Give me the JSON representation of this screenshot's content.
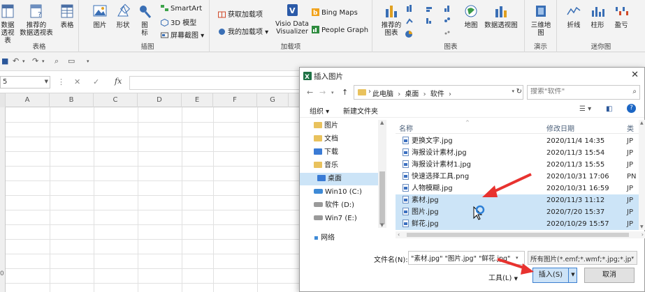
{
  "ribbon": {
    "pivot_label_1": "数据",
    "pivot_label_2": "透视表",
    "recommended_pivot_1": "推荐的",
    "recommended_pivot_2": "数据透视表",
    "table_label": "表格",
    "group_tables": "表格",
    "pictures_label": "图片",
    "shapes_label": "形状",
    "icons_label_1": "图",
    "icons_label_2": "标",
    "smartart_label": "SmartArt",
    "model3d_label": "3D 模型",
    "screenshot_label": "屏幕截图",
    "group_illustrations": "插图",
    "get_addins_label": "获取加载项",
    "my_addins_label": "我的加载项",
    "visio_label_1": "Visio Data",
    "visio_label_2": "Visualizer",
    "bing_maps_label": "Bing Maps",
    "people_graph_label": "People Graph",
    "group_addins": "加载项",
    "recommended_charts_1": "推荐的",
    "recommended_charts_2": "图表",
    "maps_label": "地图",
    "pivot_chart_label": "数据透视图",
    "group_charts": "图表",
    "map3d_label_1": "三维地",
    "map3d_label_2": "图",
    "group_tours": "演示",
    "line_label": "折线",
    "column_label": "柱形",
    "winloss_label": "盈亏",
    "group_sparklines": "迷你图"
  },
  "formula_bar": {
    "name_box": "5",
    "fx": "fx"
  },
  "grid": {
    "columns": [
      "A",
      "B",
      "C",
      "D",
      "E",
      "F",
      "G"
    ],
    "row_mark": "0"
  },
  "dialog": {
    "title": "插入图片",
    "close": "✕",
    "breadcrumb": [
      "此电脑",
      "桌面",
      "软件"
    ],
    "search_placeholder": "搜索\"软件\"",
    "organize_label": "组织 ▾",
    "new_folder_label": "新建文件夹",
    "nav_items": [
      {
        "label": "图片",
        "kind": "folder"
      },
      {
        "label": "文档",
        "kind": "folder"
      },
      {
        "label": "下载",
        "kind": "folder-blue"
      },
      {
        "label": "音乐",
        "kind": "folder"
      },
      {
        "label": "桌面",
        "kind": "folder-blue"
      },
      {
        "label": "Win10 (C:)",
        "kind": "drive-win"
      },
      {
        "label": "软件 (D:)",
        "kind": "drive"
      },
      {
        "label": "Win7 (E:)",
        "kind": "drive"
      }
    ],
    "network_label": "网络",
    "columns": {
      "name": "名称",
      "date": "修改日期",
      "type": "类"
    },
    "files": [
      {
        "name": "更换文字.jpg",
        "date": "2020/11/4 14:35",
        "type": "JP",
        "selected": false
      },
      {
        "name": "海报设计素材.jpg",
        "date": "2020/11/3 15:54",
        "type": "JP",
        "selected": false
      },
      {
        "name": "海报设计素材1.jpg",
        "date": "2020/11/3 15:55",
        "type": "JP",
        "selected": false
      },
      {
        "name": "快速选择工具.png",
        "date": "2020/10/31 17:06",
        "type": "PN",
        "selected": false
      },
      {
        "name": "人物模糊.jpg",
        "date": "2020/10/31 16:59",
        "type": "JP",
        "selected": false
      },
      {
        "name": "素材.jpg",
        "date": "2020/11/3 11:12",
        "type": "JP",
        "selected": true
      },
      {
        "name": "图片.jpg",
        "date": "2020/7/20 15:37",
        "type": "JP",
        "selected": true
      },
      {
        "name": "鲜花.jpg",
        "date": "2020/10/29 15:57",
        "type": "JP",
        "selected": true
      }
    ],
    "filename_label": "文件名(N):",
    "filename_value": "\"素材.jpg\" \"图片.jpg\" \"鲜花.jpg\"",
    "filter_value": "所有图片(*.emf;*.wmf;*.jpg;*.jp",
    "tools_label": "工具(L)",
    "insert_label": "插入(S)",
    "cancel_label": "取消"
  },
  "colors": {
    "selection": "#cce4f7",
    "annotation_arrow": "#e8322f",
    "accent_blue": "#2b579a"
  }
}
